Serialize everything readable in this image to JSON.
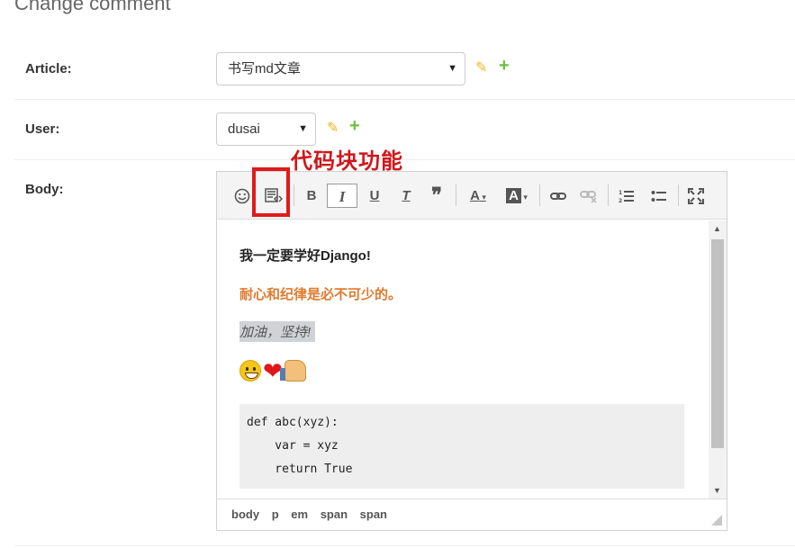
{
  "page": {
    "title": "Change comment"
  },
  "form": {
    "article": {
      "label": "Article:",
      "value": "书写md文章"
    },
    "user": {
      "label": "User:",
      "value": "dusai"
    },
    "body": {
      "label": "Body:"
    }
  },
  "annotation": {
    "text": "代码块功能",
    "color": "#d0161b"
  },
  "toolbar": {
    "buttons": [
      {
        "name": "emoticons",
        "icon": "smiley-icon"
      },
      {
        "name": "code-sample",
        "icon": "code-block-icon"
      },
      {
        "name": "bold",
        "label": "B"
      },
      {
        "name": "italic",
        "label": "I",
        "active": true
      },
      {
        "name": "underline",
        "label": "U"
      },
      {
        "name": "remove-format",
        "label": "T"
      },
      {
        "name": "blockquote",
        "label": "❞"
      },
      {
        "name": "text-color",
        "label": "A"
      },
      {
        "name": "background-color",
        "label": "A"
      },
      {
        "name": "link",
        "icon": "link-icon"
      },
      {
        "name": "unlink",
        "icon": "unlink-icon"
      },
      {
        "name": "numbered-list",
        "icon": "ordered-list-icon"
      },
      {
        "name": "bullet-list",
        "icon": "bullet-list-icon"
      },
      {
        "name": "fullscreen",
        "icon": "fullscreen-icon"
      }
    ]
  },
  "content": {
    "heading": "我一定要学好Django!",
    "orange_text": "耐心和纪律是必不可少的。",
    "orange_color": "#e07a2e",
    "em_text": "加油，坚持!",
    "heart": "❤",
    "code_lines": [
      "def abc(xyz):",
      "    var = xyz",
      "    return True"
    ]
  },
  "statusbar": {
    "path": [
      "body",
      "p",
      "em",
      "span",
      "span"
    ]
  }
}
